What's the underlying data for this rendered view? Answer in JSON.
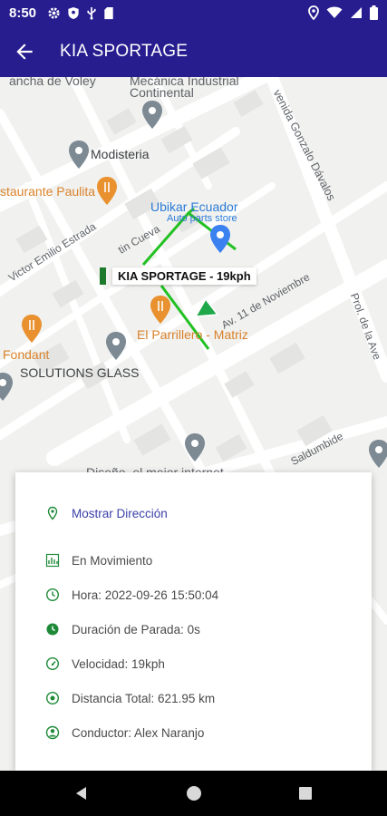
{
  "status_bar": {
    "time": "8:50"
  },
  "app_bar": {
    "title": "KIA SPORTAGE",
    "back_icon": "arrow-back-icon"
  },
  "map": {
    "labels": {
      "cancha": "ancha de Voley",
      "mecanica": "Mecánica Industrial",
      "continental": "Continental",
      "gonzalo": "venida Gonzalo Dávalos",
      "modisteria": "Modisteria",
      "paulita": "staurante Paulita",
      "ubikar": "Ubikar Ecuador",
      "autoparts": "Auto parts store",
      "estrada": "Victor Emilio Estrada",
      "cueva": "tin Cueva",
      "noviembre": "Av. 11 de Noviembre",
      "prol": "Prol. de la Ave",
      "fondant": "Fondant",
      "parrillero": "El Parrillero - Matriz",
      "solutions": "SOLUTIONS GLASS",
      "saldumbide": "Saldumbide",
      "diseno": "Diseño, el mejor internet"
    },
    "vehicle_label": "KIA SPORTAGE - 19kph",
    "colors": {
      "route": "#22c122",
      "arrow": "#1ea84a",
      "pin": "#7d8a94",
      "orange_pin": "#e8912e",
      "blue_pin": "#3b82f0"
    }
  },
  "info_card": {
    "direccion": "Mostrar Dirección",
    "estado": "En Movimiento",
    "hora": "Hora: 2022-09-26 15:50:04",
    "parada": "Duración de Parada: 0s",
    "velocidad": "Velocidad: 19kph",
    "distancia": "Distancia Total: 621.95 km",
    "conductor": "Conductor: Alex Naranjo",
    "icons": [
      "location-pin-icon",
      "chart-icon",
      "clock-icon",
      "stop-duration-icon",
      "speedometer-icon",
      "distance-icon",
      "driver-icon"
    ]
  },
  "nav_bar": {
    "back": "nav-back-icon",
    "home": "nav-home-icon",
    "recents": "nav-recents-icon"
  }
}
